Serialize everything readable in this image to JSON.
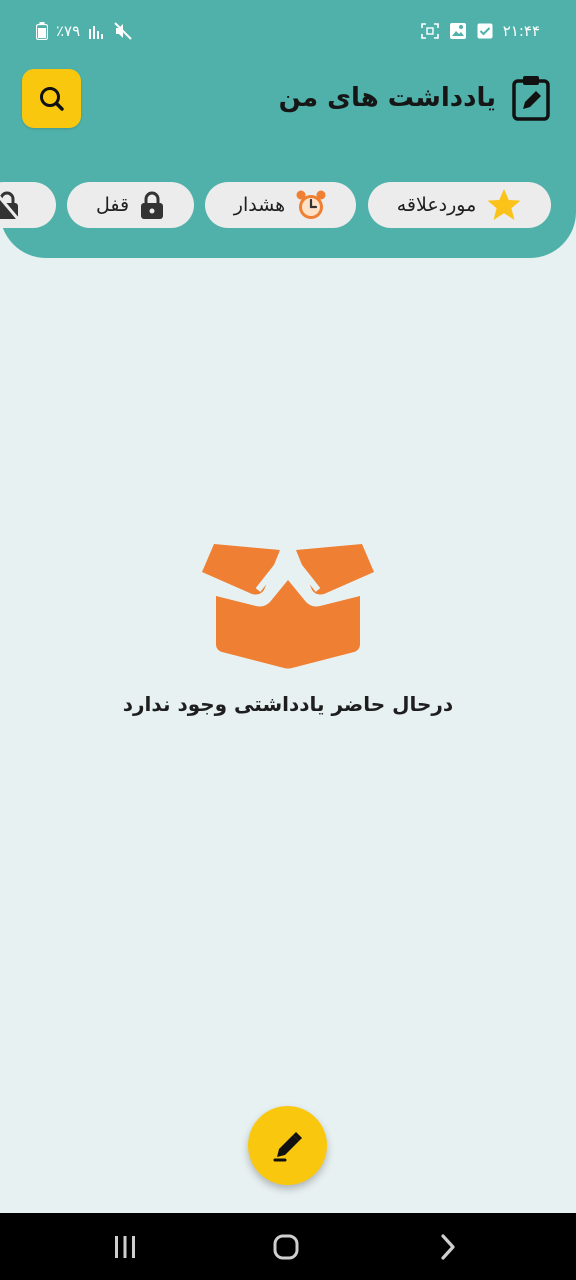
{
  "status_bar": {
    "time": "۲۱:۴۴",
    "battery": "٪۷۹"
  },
  "header": {
    "title": "یادداشت های من",
    "title_icon": "clipboard-edit-icon",
    "search_icon": "search-icon"
  },
  "filters": [
    {
      "label": "موردعلاقه",
      "icon": "star-icon"
    },
    {
      "label": "هشدار",
      "icon": "alarm-clock-icon"
    },
    {
      "label": "قفل",
      "icon": "lock-icon"
    },
    {
      "label": "",
      "icon": "lock-off-icon"
    }
  ],
  "empty_state": {
    "icon": "open-box-icon",
    "message": "درحال حاضر یادداشتی وجود ندارد"
  },
  "fab": {
    "icon": "pencil-edit-icon"
  },
  "nav": {
    "recents_icon": "recents-icon",
    "home_icon": "home-icon",
    "back_icon": "back-icon"
  },
  "colors": {
    "header": "#4fb1a9",
    "accent": "#f9c80e",
    "background": "#e8f1f2",
    "box": "#ef7f33",
    "chip": "#ececec"
  }
}
